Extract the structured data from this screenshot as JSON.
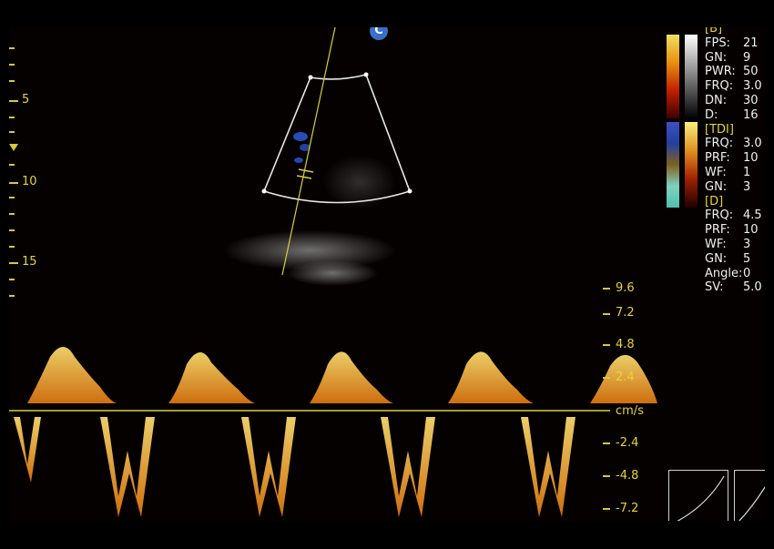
{
  "marker": {
    "label": "C"
  },
  "depth_scale": {
    "labels": [
      "5",
      "10",
      "15"
    ]
  },
  "velocity_scale": {
    "labels": [
      "9.6",
      "7.2",
      "4.8",
      "2.4",
      "cm/s",
      "-2.4",
      "-4.8",
      "-7.2"
    ],
    "unit": "cm/s"
  },
  "params": {
    "b_header": "[B]",
    "b_rows": [
      {
        "k": "FPS:",
        "v": "21"
      },
      {
        "k": "GN:",
        "v": "9"
      },
      {
        "k": "PWR:",
        "v": "50"
      },
      {
        "k": "FRQ:",
        "v": "3.0"
      },
      {
        "k": "DN:",
        "v": "30"
      },
      {
        "k": "D:",
        "v": "16"
      }
    ],
    "tdi_header": "[TDI]",
    "tdi_rows": [
      {
        "k": "FRQ:",
        "v": "3.0"
      },
      {
        "k": "PRF:",
        "v": "10"
      },
      {
        "k": "WF:",
        "v": "1"
      },
      {
        "k": "GN:",
        "v": "3"
      }
    ],
    "d_header": "[D]",
    "d_rows": [
      {
        "k": "FRQ:",
        "v": "4.5"
      },
      {
        "k": "PRF:",
        "v": "10"
      },
      {
        "k": "WF:",
        "v": "3"
      },
      {
        "k": "GN:",
        "v": "5"
      },
      {
        "k": "Angle:",
        "v": "0"
      },
      {
        "k": "SV:",
        "v": "5.0"
      }
    ]
  },
  "colors": {
    "accent_yellow": "#e6d43a",
    "doppler_orange": "#f0a020",
    "badge_blue": "#3a6fc9"
  }
}
